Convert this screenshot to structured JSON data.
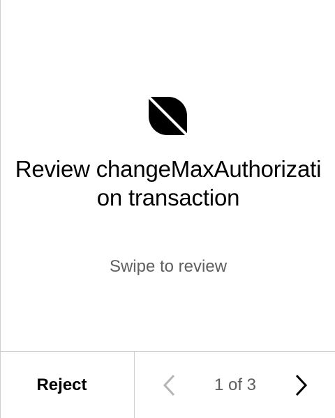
{
  "review": {
    "logo_icon": "ledger-app-logo-icon",
    "title": "Review changeMaxAuthorization transaction",
    "subtitle": "Swipe to review"
  },
  "footer": {
    "reject_label": "Reject",
    "page_label": "1 of 3",
    "prev_icon": "chevron-left-icon",
    "next_icon": "chevron-right-icon"
  },
  "colors": {
    "text": "#000000",
    "secondary_text": "#5f5f5f",
    "disabled_chevron": "#b5b5b5",
    "divider": "#cfcfcf",
    "background": "#ffffff"
  }
}
